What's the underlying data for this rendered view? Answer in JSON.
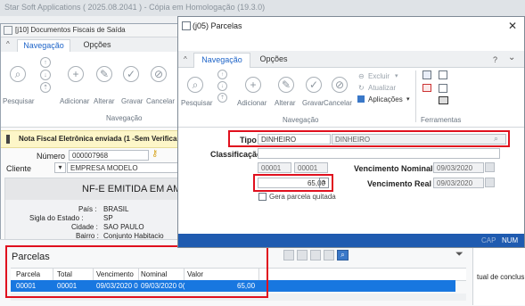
{
  "app": {
    "title": "Star Soft Applications ( 2025.08.2041 ) - Cópia em Homologação (19.3.0)"
  },
  "left_window": {
    "title": "[j10]  Documentos Fiscais de Saída",
    "tabs": [
      "Navegação",
      "Opções"
    ],
    "toolbar": {
      "pesquisar": "Pesquisar",
      "adicionar": "Adicionar",
      "alterar": "Alterar",
      "gravar": "Gravar",
      "cancelar": "Cancelar",
      "group": "Navegação"
    },
    "banner": "Nota Fiscal Eletrônica enviada (1 -Sem Verifica",
    "numero_label": "Número",
    "numero_value": "000007968",
    "cliente_label": "Cliente",
    "cliente_value": "EMPRESA MODELO",
    "status": "NF-E EMITIDA EM AM",
    "pais_label": "País :",
    "pais_value": "BRASIL",
    "sigla_label": "Sigla do Estado :",
    "sigla_value": "SP",
    "cidade_label": "Cidade :",
    "cidade_value": "SAO PAULO",
    "bairro_label": "Bairro :",
    "bairro_value": "Conjunto Habitacio"
  },
  "parcelas_panel": {
    "title": "Parcelas",
    "columns": [
      "Parcela",
      "Total",
      "Vencimento",
      "Nominal",
      "Valor"
    ],
    "rows": [
      {
        "parcela": "00001",
        "total": "00001",
        "vencimento": "09/03/2020 0",
        "nominal": "09/03/2020 0(",
        "valor": "65,00"
      }
    ],
    "right_fragment": "tual de conclus"
  },
  "dialog": {
    "title": "(j05)  Parcelas",
    "tabs": [
      "Navegação",
      "Opções"
    ],
    "help": "?",
    "toolbar": {
      "pesquisar": "Pesquisar",
      "adicionar": "Adicionar",
      "alterar": "Alterar",
      "gravar": "Gravar",
      "cancelar": "Cancelar",
      "excluir": "Excluir",
      "atualizar": "Atualizar",
      "aplicacoes": "Aplicações",
      "nav_group": "Navegação",
      "tools_group": "Ferramentas"
    },
    "tipo_label": "Tipo",
    "tipo_code": "DINHEIRO",
    "tipo_desc": "DINHEIRO",
    "classificacao_label": "Classificação",
    "parcela_num": "00001",
    "parcela_total": "00001",
    "valor": "65,00",
    "venc_nominal_label": "Vencimento Nominal",
    "venc_nominal_value": "09/03/2020",
    "venc_real_label": "Vencimento Real",
    "venc_real_value": "09/03/2020",
    "gera_quitada": "Gera parcela quitada",
    "status_cap": "CAP",
    "status_num": "NUM"
  },
  "colors": {
    "accent": "#1e64c8",
    "selected_row": "#1877e0",
    "highlight": "#e0101e",
    "statusbar": "#1f5bb0"
  }
}
